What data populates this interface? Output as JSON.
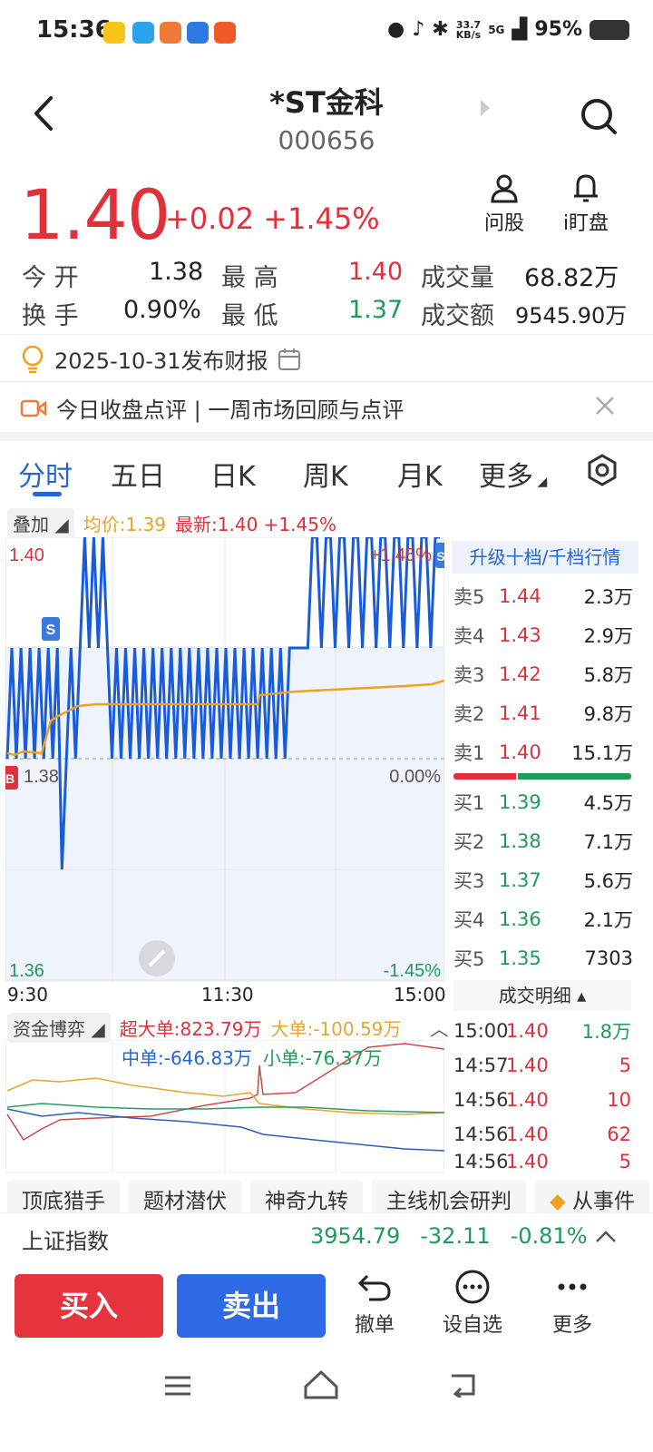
{
  "status_bar": {
    "time": "15:36",
    "net_speed": "33.7",
    "net_unit": "KB/s",
    "signal": "5G",
    "battery": "95%"
  },
  "header": {
    "title": "*ST金科",
    "code": "000656"
  },
  "quote": {
    "price": "1.40",
    "change": "+0.02 +1.45%",
    "ask_stock_label": "问股",
    "watch_label": "i盯盘",
    "open_label": "今  开",
    "open": "1.38",
    "high_label": "最  高",
    "high": "1.40",
    "volume_label": "成交量",
    "volume": "68.82万",
    "turnover_label": "换  手",
    "turnover": "0.90%",
    "low_label": "最  低",
    "low": "1.37",
    "amount_label": "成交额",
    "amount": "9545.90万"
  },
  "notices": {
    "report": "2025-10-31发布财报",
    "review": "今日收盘点评 | 一周市场回顾与点评"
  },
  "tabs": [
    "分时",
    "五日",
    "日K",
    "周K",
    "月K",
    "更多"
  ],
  "overlay": {
    "label": "叠加",
    "avg": "均价:1.39",
    "latest": "最新:1.40 +1.45%"
  },
  "chart": {
    "y_top": "1.40",
    "y_mid": "1.38",
    "y_bottom": "1.36",
    "pct_top": "+1.45%",
    "pct_mid": "0.00%",
    "pct_bottom": "-1.45%",
    "x_labels": [
      "9:30",
      "11:30",
      "15:00"
    ],
    "marker_s": "S",
    "marker_b": "B"
  },
  "order_book": {
    "header": "升级十档/千档行情",
    "asks": [
      {
        "label": "卖5",
        "price": "1.44",
        "vol": "2.3万"
      },
      {
        "label": "卖4",
        "price": "1.43",
        "vol": "2.9万"
      },
      {
        "label": "卖3",
        "price": "1.42",
        "vol": "5.8万"
      },
      {
        "label": "卖2",
        "price": "1.41",
        "vol": "9.8万"
      },
      {
        "label": "卖1",
        "price": "1.40",
        "vol": "15.1万"
      }
    ],
    "bids": [
      {
        "label": "买1",
        "price": "1.39",
        "vol": "4.5万"
      },
      {
        "label": "买2",
        "price": "1.38",
        "vol": "7.1万"
      },
      {
        "label": "买3",
        "price": "1.37",
        "vol": "5.6万"
      },
      {
        "label": "买4",
        "price": "1.36",
        "vol": "2.1万"
      },
      {
        "label": "买5",
        "price": "1.35",
        "vol": "7303"
      }
    ],
    "buy_ratio": 0.35
  },
  "trades": {
    "header": "成交明细",
    "rows": [
      {
        "time": "15:00",
        "price": "1.40",
        "vol": "1.8万"
      },
      {
        "time": "14:57",
        "price": "1.40",
        "vol": "5"
      },
      {
        "time": "14:56",
        "price": "1.40",
        "vol": "10"
      },
      {
        "time": "14:56",
        "price": "1.40",
        "vol": "62"
      },
      {
        "time": "14:56",
        "price": "1.40",
        "vol": "5"
      }
    ]
  },
  "capital": {
    "label": "资金博弈",
    "super_large": "超大单:823.79万",
    "large": "大单:-100.59万",
    "medium": "中单:-646.83万",
    "small": "小单:-76.37万"
  },
  "features": [
    "顶底猎手",
    "题材潜伏",
    "神奇九转",
    "主线机会研判",
    "从事件"
  ],
  "index": {
    "name": "上证指数",
    "value": "3954.79",
    "change": "-32.11",
    "pct": "-0.81%"
  },
  "actions": {
    "buy": "买入",
    "sell": "卖出",
    "cancel": "撤单",
    "watchlist": "设自选",
    "more": "更多"
  },
  "colors": {
    "up": "#e0303a",
    "down": "#1f9a5a",
    "accent": "#2366d1",
    "avg_line": "#f0a020"
  }
}
